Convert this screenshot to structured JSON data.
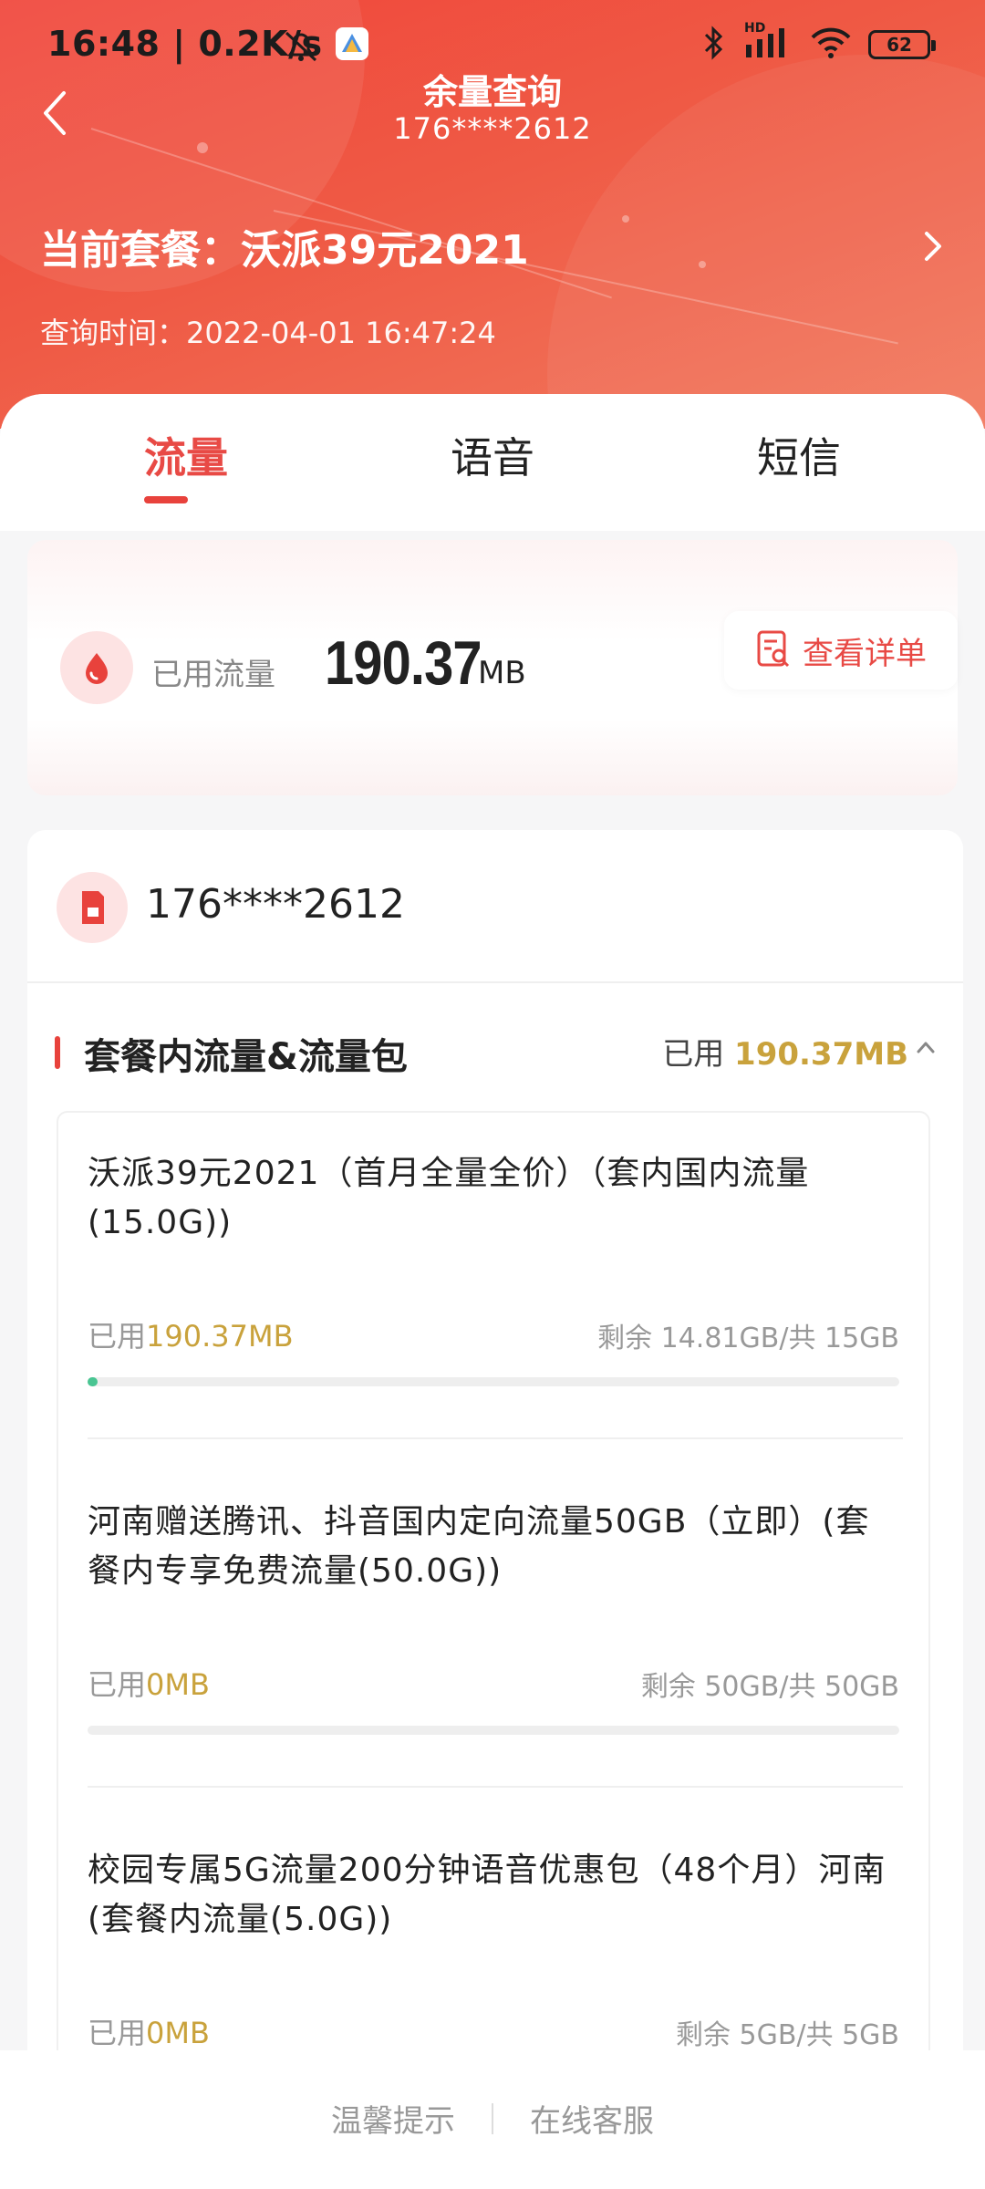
{
  "status_bar": {
    "time": "16:48",
    "network_speed": "0.2K/s",
    "battery": "62",
    "signal_label": "HD"
  },
  "header": {
    "title": "余量查询",
    "phone": "176****2612",
    "plan_label": "当前套餐：",
    "plan_name": "沃派39元2021",
    "query_time": "查询时间：2022-04-01 16:47:24"
  },
  "tabs": [
    {
      "label": "流量",
      "active": true
    },
    {
      "label": "语音",
      "active": false
    },
    {
      "label": "短信",
      "active": false
    }
  ],
  "usage": {
    "label": "已用流量",
    "value": "190.37",
    "unit": "MB",
    "detail_button": "查看详单"
  },
  "account": {
    "phone": "176****2612"
  },
  "section": {
    "title": "套餐内流量&流量包",
    "used_prefix": "已用",
    "used_value": "190.37MB"
  },
  "items": [
    {
      "title": "沃派39元2021（首月全量全价）（套内国内流量(15.0G))",
      "used_prefix": "已用",
      "used_value": "190.37MB",
      "remain": "剩余 14.81GB/共 15GB",
      "progress": 0.012
    },
    {
      "title": "河南赠送腾讯、抖音国内定向流量50GB（立即）(套餐内专享免费流量(50.0G))",
      "used_prefix": "已用",
      "used_value": "0MB",
      "remain": "剩余 50GB/共 50GB",
      "progress": 0
    },
    {
      "title": "校园专属5G流量200分钟语音优惠包（48个月）河南(套餐内流量(5.0G))",
      "used_prefix": "已用",
      "used_value": "0MB",
      "remain": "剩余 5GB/共 5GB",
      "progress": 0
    }
  ],
  "footer": {
    "tips": "温馨提示",
    "service": "在线客服"
  },
  "colors": {
    "brand_red": "#e84a45",
    "gold": "#c9a23c",
    "progress_green": "#49c592"
  }
}
